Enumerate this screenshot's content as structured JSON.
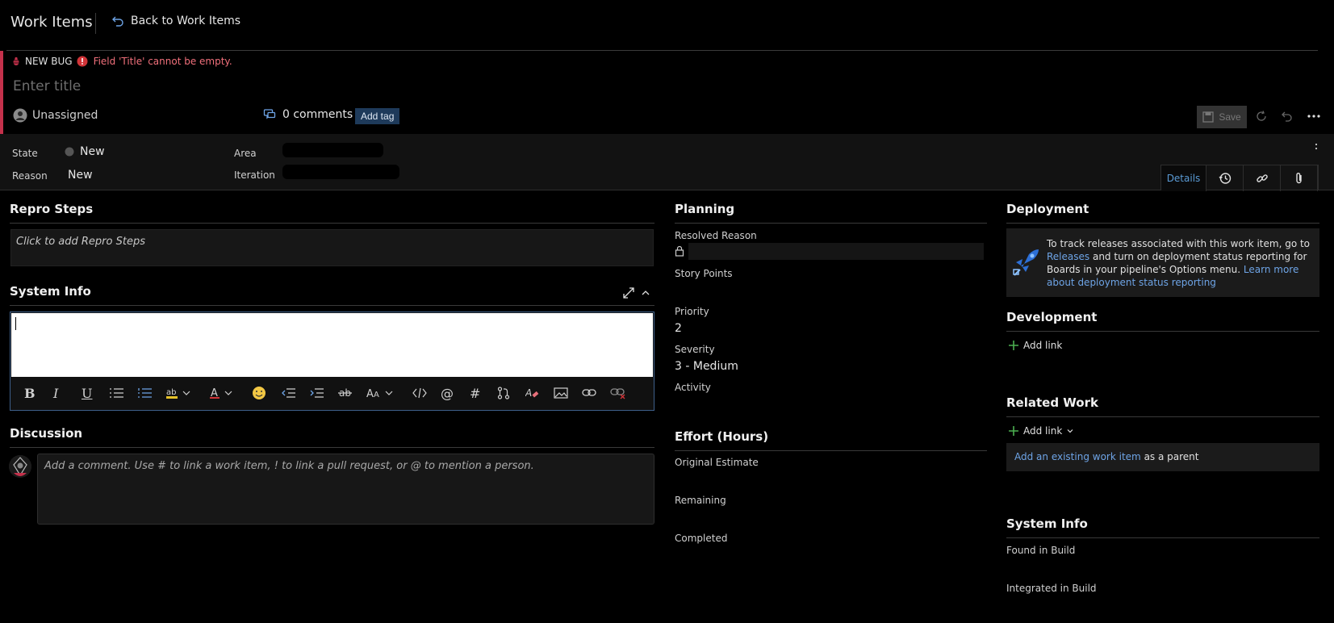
{
  "topbar": {
    "title": "Work Items",
    "back_label": "Back to Work Items"
  },
  "header": {
    "type_label": "NEW BUG",
    "error": "Field 'Title' cannot be empty.",
    "title_placeholder": "Enter title",
    "assignee": "Unassigned",
    "comments": "0 comments",
    "add_tag": "Add tag",
    "save": "Save"
  },
  "fields": {
    "state_label": "State",
    "state_value": "New",
    "reason_label": "Reason",
    "reason_value": "New",
    "area_label": "Area",
    "iteration_label": "Iteration"
  },
  "tabs": {
    "details": "Details"
  },
  "left": {
    "repro_title": "Repro Steps",
    "repro_placeholder": "Click to add Repro Steps",
    "sysinfo_title": "System Info",
    "discussion_title": "Discussion",
    "comment_placeholder": "Add a comment. Use # to link a work item, ! to link a pull request, or @ to mention a person."
  },
  "planning": {
    "title": "Planning",
    "resolved_reason_label": "Resolved Reason",
    "story_points_label": "Story Points",
    "priority_label": "Priority",
    "priority_value": "2",
    "severity_label": "Severity",
    "severity_value": "3 - Medium",
    "activity_label": "Activity"
  },
  "effort": {
    "title": "Effort (Hours)",
    "original_label": "Original Estimate",
    "remaining_label": "Remaining",
    "completed_label": "Completed"
  },
  "deployment": {
    "title": "Deployment",
    "text_1": "To track releases associated with this work item, go to",
    "releases_link": "Releases",
    "text_2": "and turn on deployment status reporting for Boards in your pipeline's Options menu.",
    "learn_link": "Learn more about deployment status reporting"
  },
  "development": {
    "title": "Development",
    "add_link": "Add link"
  },
  "related": {
    "title": "Related Work",
    "add_link": "Add link",
    "existing_link": "Add an existing work item",
    "as_parent": "as a parent"
  },
  "sysinfo_right": {
    "title": "System Info",
    "found_label": "Found in Build",
    "integrated_label": "Integrated in Build"
  },
  "colors": {
    "error_red": "#c4314b",
    "link_blue": "#6ea4e6",
    "add_green": "#4caf50"
  }
}
